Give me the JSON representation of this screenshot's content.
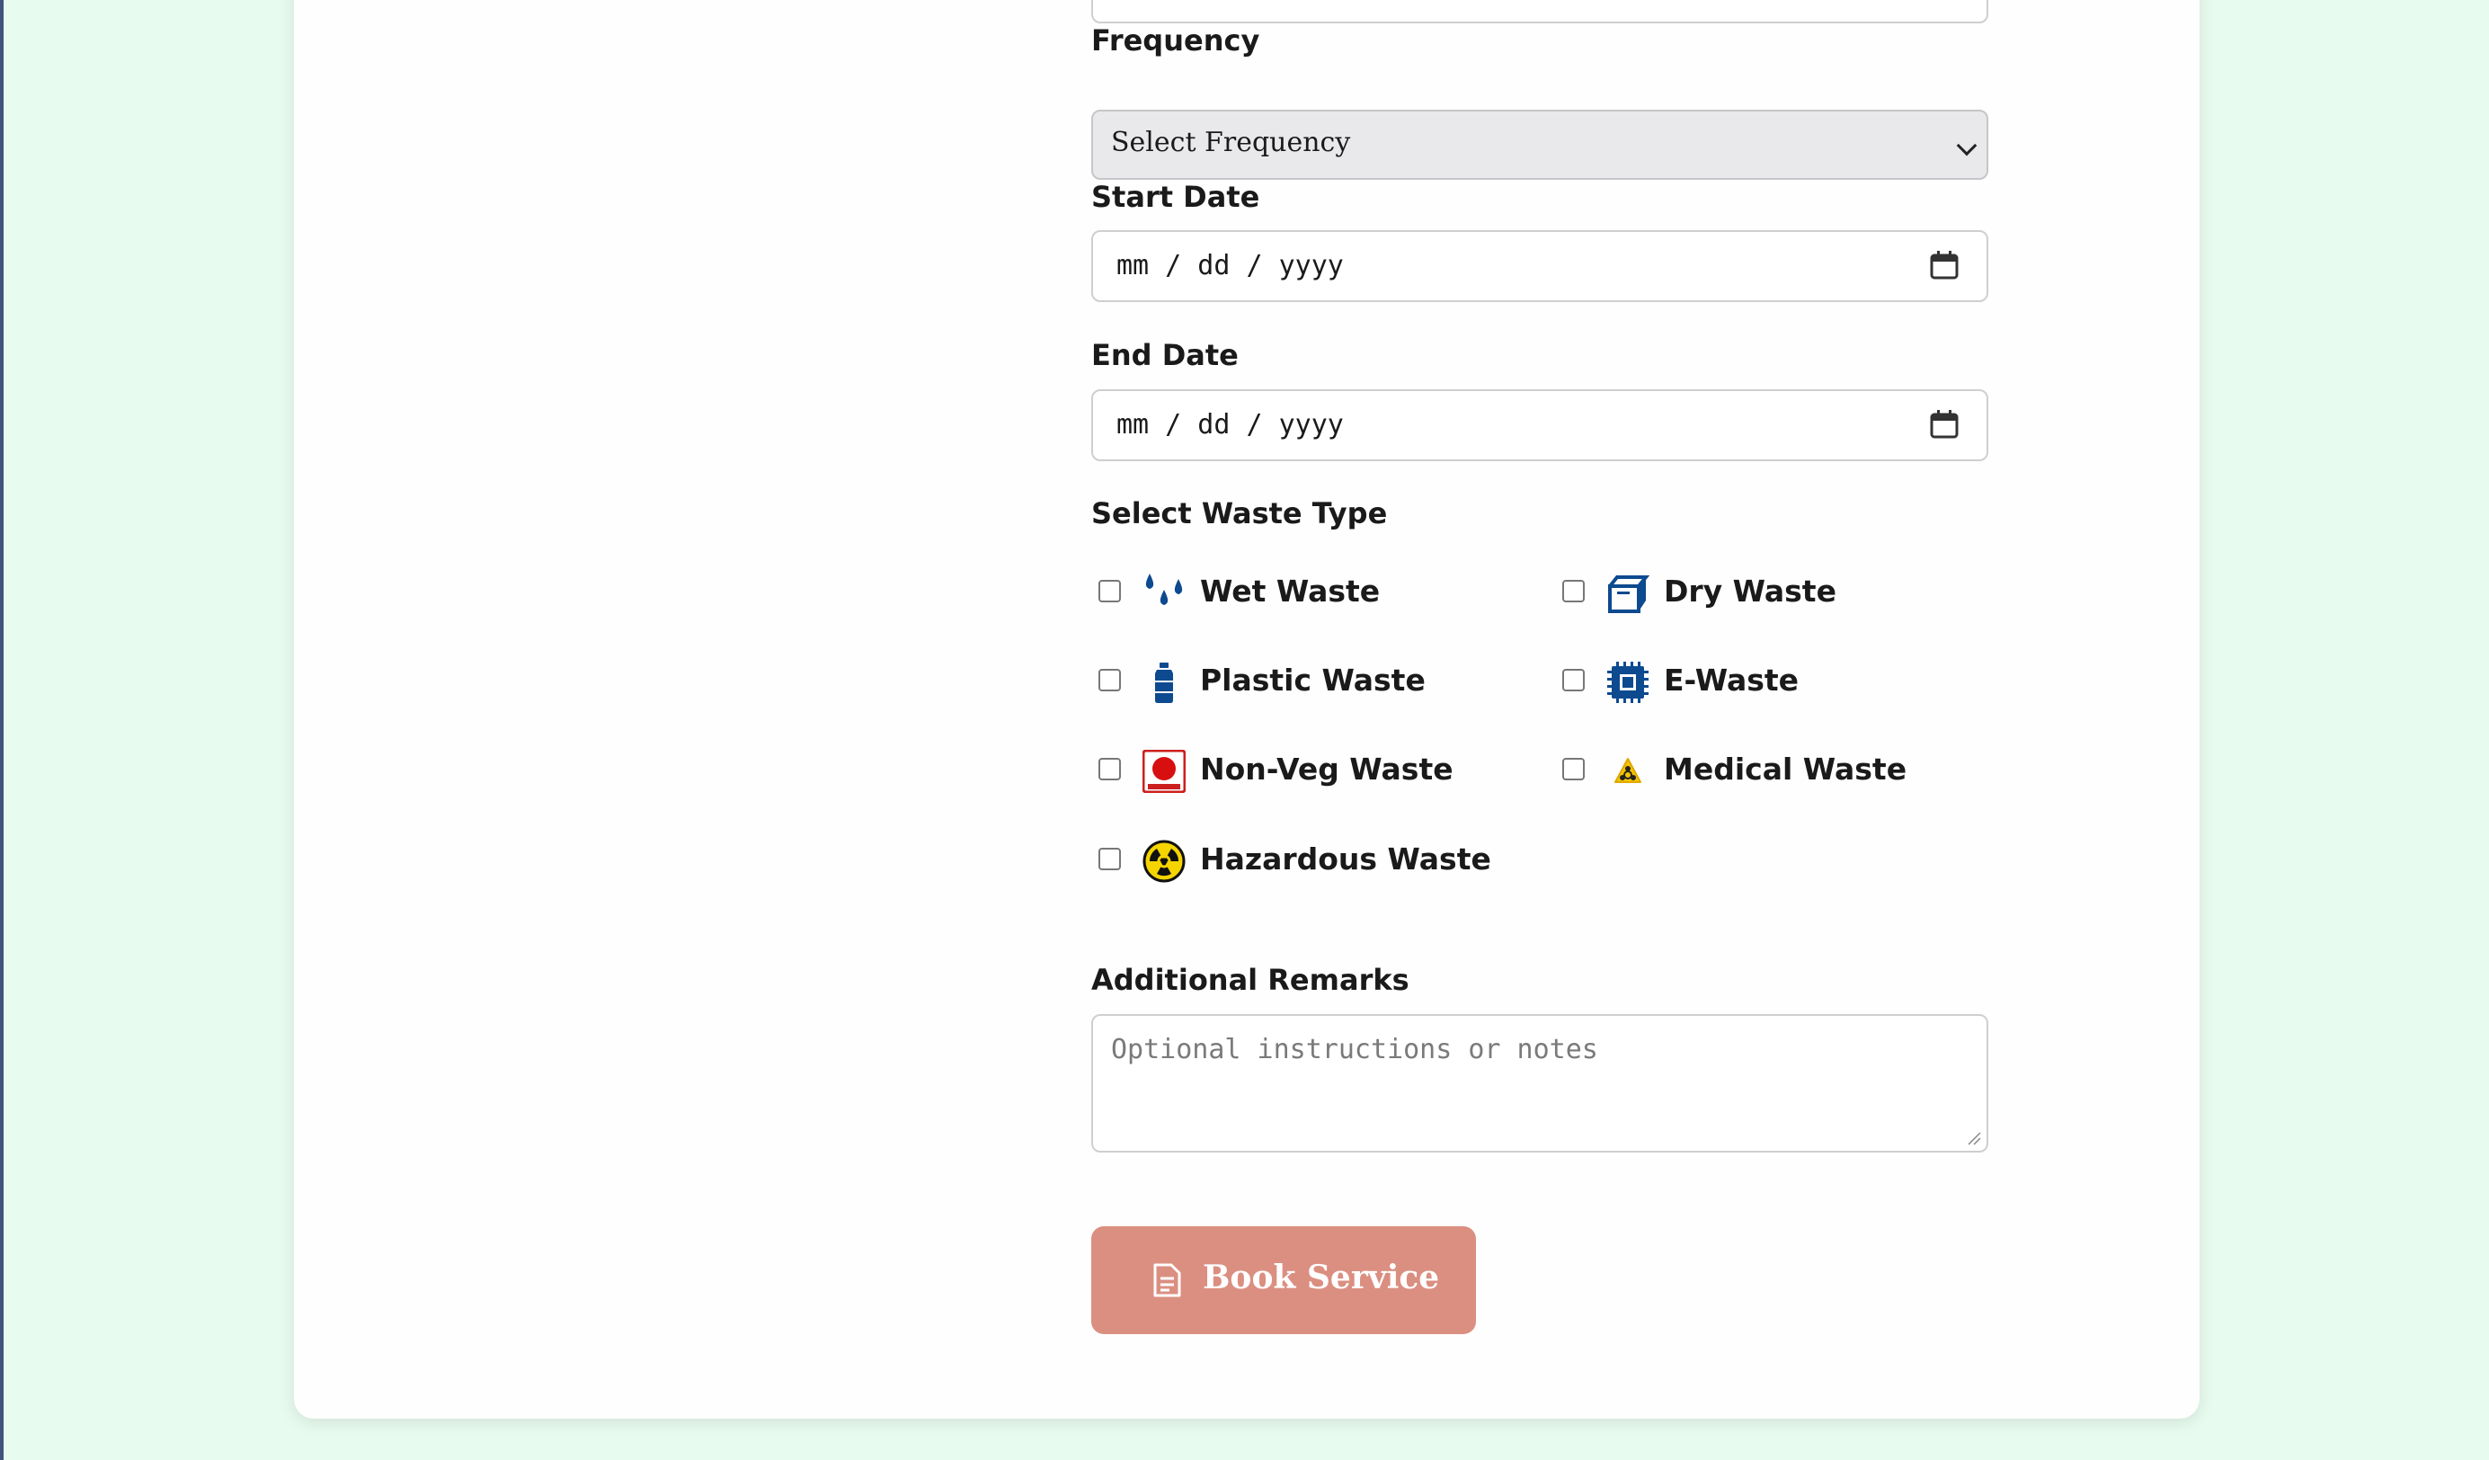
{
  "form": {
    "frequency": {
      "label": "Frequency",
      "value": "Select Frequency"
    },
    "start_date": {
      "label": "Start Date",
      "placeholder": "mm / dd / yyyy"
    },
    "end_date": {
      "label": "End Date",
      "placeholder": "mm / dd / yyyy"
    },
    "waste_type": {
      "label": "Select Waste Type",
      "options": [
        {
          "label": "Wet Waste",
          "icon": "water-drops-icon",
          "checked": false
        },
        {
          "label": "Dry Waste",
          "icon": "box-icon",
          "checked": false
        },
        {
          "label": "Plastic Waste",
          "icon": "bottle-icon",
          "checked": false
        },
        {
          "label": "E-Waste",
          "icon": "chip-icon",
          "checked": false
        },
        {
          "label": "Non-Veg Waste",
          "icon": "non-veg-icon",
          "checked": false
        },
        {
          "label": "Medical Waste",
          "icon": "biohazard-icon",
          "checked": false
        },
        {
          "label": "Hazardous Waste",
          "icon": "radiation-icon",
          "checked": false
        }
      ]
    },
    "remarks": {
      "label": "Additional Remarks",
      "placeholder": "Optional instructions or notes"
    },
    "submit_label": "Book Service"
  },
  "colors": {
    "page_background": "#e8fbef",
    "card_background": "#fefefe",
    "button_background": "#db8f81",
    "icon_blue": "#0d4a8f"
  }
}
